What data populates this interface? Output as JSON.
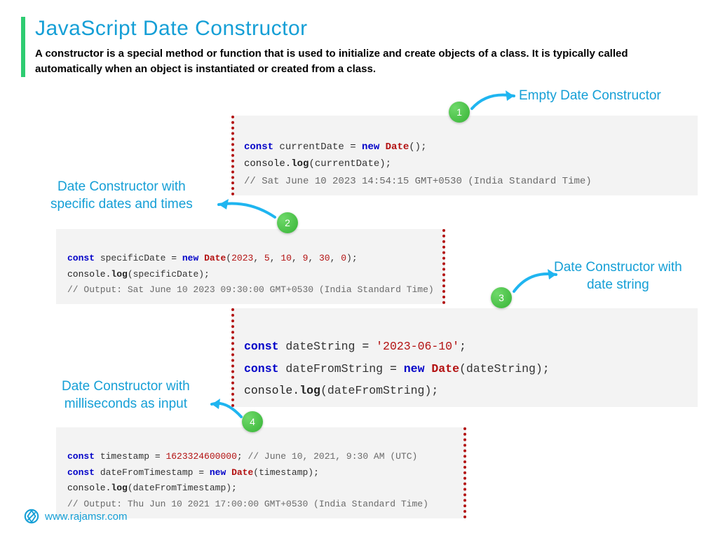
{
  "header": {
    "title": "JavaScript Date Constructor",
    "subtitle": "A constructor is a special method or function that is used to initialize and create objects of a class. It is typically called automatically when an object is instantiated or created from a class."
  },
  "labels": {
    "l1": "Empty Date Constructor",
    "l2": "Date Constructor with\nspecific dates and times",
    "l3": "Date Constructor with\ndate string",
    "l4": "Date Constructor with\nmilliseconds as input"
  },
  "badges": {
    "b1": "1",
    "b2": "2",
    "b3": "3",
    "b4": "4"
  },
  "code": {
    "c1": {
      "kw1": "const",
      "v1": " currentDate ",
      "op1": "= ",
      "kw2": "new ",
      "cls": "Date",
      "args": "();",
      "line2a": "console.",
      "log": "log",
      "line2b": "(currentDate);",
      "cmt": "// Sat June 10 2023 14:54:15 GMT+0530 (India Standard Time)"
    },
    "c2": {
      "kw1": "const",
      "v1": " specificDate ",
      "op1": "= ",
      "kw2": "new ",
      "cls": "Date",
      "args_open": "(",
      "n1": "2023",
      "c": ", ",
      "n2": "5",
      "n3": "10",
      "n4": "9",
      "n5": "30",
      "n6": "0",
      "args_close": ");",
      "line2a": "console.",
      "log": "log",
      "line2b": "(specificDate);",
      "cmt": "// Output: Sat June 10 2023 09:30:00 GMT+0530 (India Standard Time)"
    },
    "c3": {
      "kw1": "const",
      "v1": " dateString ",
      "op1": "= ",
      "str": "'2023-06-10'",
      "semi": ";",
      "kw2": "const",
      "v2": " dateFromString ",
      "op2": "= ",
      "kw3": "new ",
      "cls": "Date",
      "args": "(dateString);",
      "line3a": "console.",
      "log": "log",
      "line3b": "(dateFromString);"
    },
    "c4": {
      "kw1": "const",
      "v1": " timestamp ",
      "op1": "= ",
      "num": "1623324600000",
      "semi": ";",
      "cmt1": " // June 10, 2021, 9:30 AM (UTC)",
      "kw2": "const",
      "v2": " dateFromTimestamp ",
      "op2": "= ",
      "kw3": "new ",
      "cls": "Date",
      "args": "(timestamp);",
      "line3a": "console.",
      "log": "log",
      "line3b": "(dateFromTimestamp);",
      "cmt2": "// Output: Thu Jun 10 2021 17:00:00 GMT+0530 (India Standard Time)"
    }
  },
  "footer": {
    "link": "www.rajamsr.com"
  }
}
